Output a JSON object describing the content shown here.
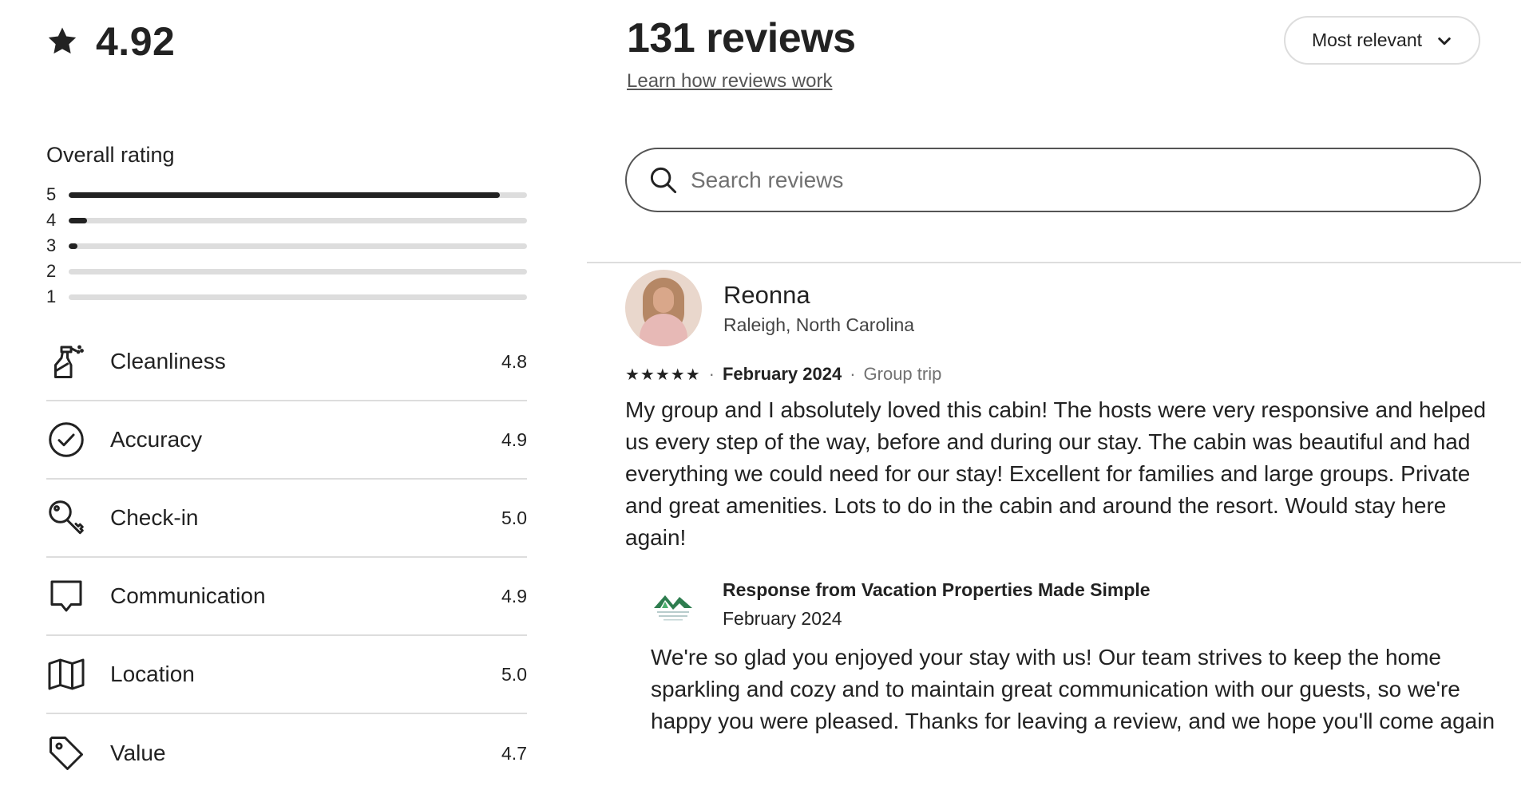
{
  "rating": {
    "score": "4.92",
    "icon": "star-icon"
  },
  "overall": {
    "label": "Overall rating",
    "distribution": [
      {
        "stars": "5",
        "fraction": 0.94
      },
      {
        "stars": "4",
        "fraction": 0.04
      },
      {
        "stars": "3",
        "fraction": 0.02
      },
      {
        "stars": "2",
        "fraction": 0.0
      },
      {
        "stars": "1",
        "fraction": 0.0
      }
    ]
  },
  "categories": [
    {
      "name": "Cleanliness",
      "value": "4.8",
      "icon": "spray-bottle-icon"
    },
    {
      "name": "Accuracy",
      "value": "4.9",
      "icon": "check-circle-icon"
    },
    {
      "name": "Check-in",
      "value": "5.0",
      "icon": "key-icon"
    },
    {
      "name": "Communication",
      "value": "4.9",
      "icon": "chat-bubble-icon"
    },
    {
      "name": "Location",
      "value": "5.0",
      "icon": "map-icon"
    },
    {
      "name": "Value",
      "value": "4.7",
      "icon": "tag-icon"
    }
  ],
  "header": {
    "reviews_count": "131 reviews",
    "learn_link": "Learn how reviews work",
    "sort_label": "Most relevant"
  },
  "search": {
    "placeholder": "Search reviews"
  },
  "review": {
    "name": "Reonna",
    "location": "Raleigh, North Carolina",
    "stars": "★★★★★",
    "date": "February 2024",
    "trip": "Group trip",
    "text": "My group and I absolutely loved this cabin! The hosts were very responsive and helped us every step of the way, before and during our stay. The cabin was beautiful and had everything we could need for our stay! Excellent for families and large groups. Private and great amenities. Lots to do in the cabin and around the resort. Would stay here again!",
    "response": {
      "from": "Response from Vacation Properties Made Simple",
      "date": "February 2024",
      "text": "We're so glad you enjoyed your stay with us! Our team strives to keep the home sparkling and cozy and to maintain great communication with our guests, so we're happy you were pleased. Thanks for leaving a review, and we hope you'll come again"
    }
  },
  "colors": {
    "text": "#222222",
    "muted": "#717171",
    "divider": "#dddddd",
    "logo_green": "#2e7d4f"
  }
}
